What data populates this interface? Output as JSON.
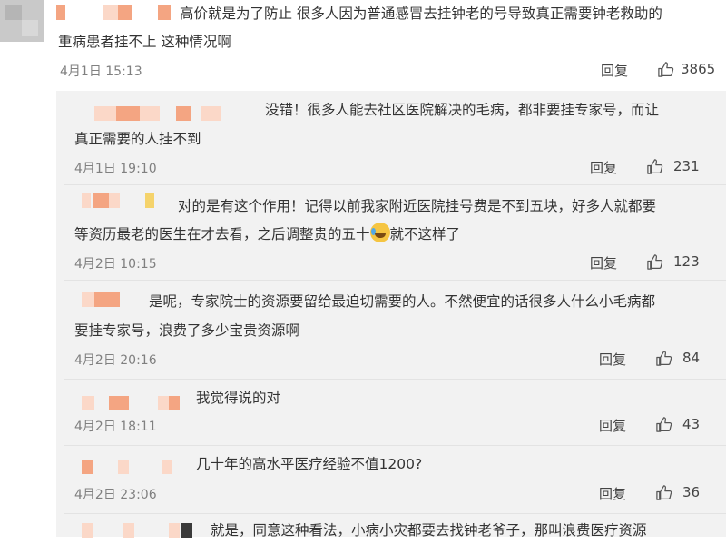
{
  "comments": [
    {
      "text_line1": "高价就是为了防止  很多人因为普通感冒去挂钟老的号导致真正需要钟老救助的",
      "text_line2": "重病患者挂不上   这种情况啊",
      "time": "4月1日 15:13",
      "reply": "回复",
      "likes": "3865"
    }
  ],
  "replies": [
    {
      "text_line1": "没错！很多人能去社区医院解决的毛病，都非要挂专家号，而让",
      "text_line2": "真正需要的人挂不到",
      "time": "4月1日 19:10",
      "reply": "回复",
      "likes": "231"
    },
    {
      "text_line1": "对的是有这个作用！记得以前我家附近医院挂号费是不到五块，好多人就都要",
      "text_line2_before": "等资历最老的医生在才去看，之后调整贵的五十",
      "text_line2_after": "就不这样了",
      "time": "4月2日 10:15",
      "reply": "回复",
      "likes": "123"
    },
    {
      "text_line1": "是呢，专家院士的资源要留给最迫切需要的人。不然便宜的话很多人什么小毛病都",
      "text_line2": "要挂专家号，浪费了多少宝贵资源啊",
      "time": "4月2日 20:16",
      "reply": "回复",
      "likes": "84"
    },
    {
      "text_line1": "我觉得说的对",
      "time": "4月2日 18:11",
      "reply": "回复",
      "likes": "43"
    },
    {
      "text_line1": "几十年的高水平医疗经验不值1200?",
      "time": "4月2日 23:06",
      "reply": "回复",
      "likes": "36"
    },
    {
      "text_line1": "就是，同意这种看法，小病小灾都要去找钟老爷子，那叫浪费医疗资源"
    }
  ],
  "icons": {
    "like": "thumbs-up-icon",
    "emoji": "laugh-cry-emoji-icon"
  },
  "colors": {
    "mosaic_orange": "#f4a582",
    "mosaic_light": "#fbd8c8",
    "reply_bg": "#f2f2f2",
    "time_gray": "#808080"
  }
}
